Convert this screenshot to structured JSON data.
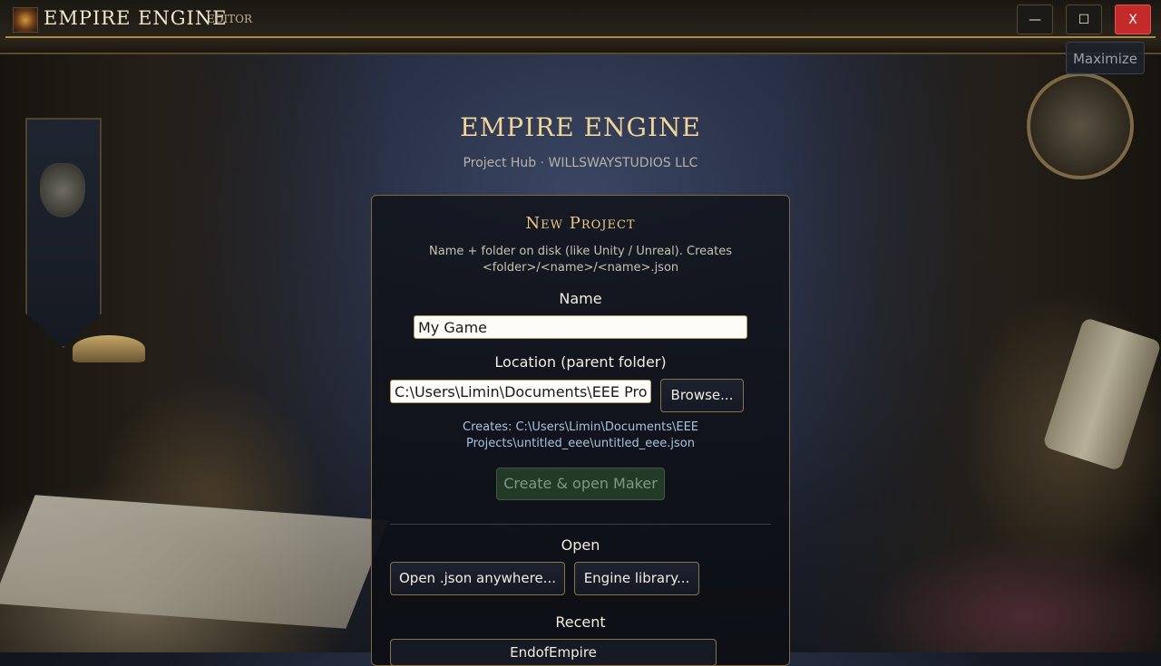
{
  "titlebar": {
    "app_name": "EMPIRE ENGINE",
    "subtitle": "EDITOR",
    "minimize_label": "—",
    "maximize_label": "☐",
    "close_label": "X"
  },
  "maximize_button": "Maximize",
  "header": {
    "title": "EMPIRE ENGINE",
    "subtitle": "Project Hub · WILLSWAYSTUDIOS LLC"
  },
  "new_project": {
    "title": "New Project",
    "description": "Name + folder on disk (like Unity / Unreal). Creates <folder>/<name>/<name>.json",
    "name_label": "Name",
    "name_value": "My Game",
    "location_label": "Location (parent folder)",
    "location_value": "C:\\Users\\Limin\\Documents\\EEE Projects",
    "browse_label": "Browse...",
    "creates_text": "Creates: C:\\Users\\Limin\\Documents\\EEE Projects\\untitled_eee\\untitled_eee.json",
    "create_label": "Create & open Maker"
  },
  "open_section": {
    "title": "Open",
    "open_json_label": "Open .json anywhere...",
    "engine_library_label": "Engine library..."
  },
  "recent": {
    "title": "Recent",
    "items": [
      "EndofEmpire"
    ]
  },
  "colors": {
    "accent_gold": "#e8c98a",
    "close_red": "#c42a2a",
    "create_disabled_green": "#233a29",
    "creates_path_blue": "#a9c4de"
  }
}
